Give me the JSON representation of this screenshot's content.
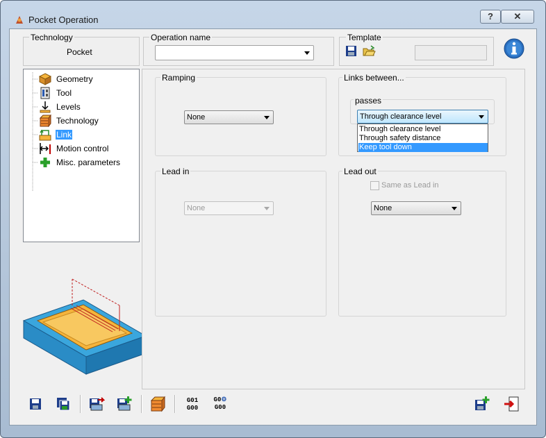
{
  "window": {
    "title": "Pocket Operation",
    "help_label": "?",
    "close_label": "✕"
  },
  "technology": {
    "label": "Technology",
    "value": "Pocket"
  },
  "operation_name": {
    "label": "Operation name",
    "value": ""
  },
  "template": {
    "label": "Template",
    "value": ""
  },
  "tree": {
    "items": [
      {
        "label": "Geometry",
        "icon": "geometry-icon"
      },
      {
        "label": "Tool",
        "icon": "tool-icon"
      },
      {
        "label": "Levels",
        "icon": "levels-icon"
      },
      {
        "label": "Technology",
        "icon": "technology-icon"
      },
      {
        "label": "Link",
        "icon": "link-icon",
        "selected": true
      },
      {
        "label": "Motion control",
        "icon": "motion-control-icon"
      },
      {
        "label": "Misc. parameters",
        "icon": "misc-parameters-icon"
      }
    ]
  },
  "ramping": {
    "title": "Ramping",
    "value": "None"
  },
  "links_between": {
    "title": "Links between...",
    "passes": {
      "title": "passes",
      "value": "Through clearance level",
      "options": [
        "Through clearance level",
        "Through safety distance",
        "Keep tool down"
      ],
      "highlighted": "Keep tool down"
    }
  },
  "lead_in": {
    "title": "Lead in",
    "value": "None",
    "disabled": true
  },
  "lead_out": {
    "title": "Lead out",
    "same_as_lead_in": "Same as Lead in",
    "same_as_checked": false,
    "value": "None"
  },
  "toolbar": {
    "gcode_a": [
      "G01",
      "G00"
    ],
    "gcode_b": [
      "G0",
      "G00"
    ]
  },
  "colors": {
    "selection": "#3399ff",
    "title_gradient": "#c6d6e8",
    "part_blue": "#3aa6dd",
    "pocket_orange": "#f5b43c"
  }
}
